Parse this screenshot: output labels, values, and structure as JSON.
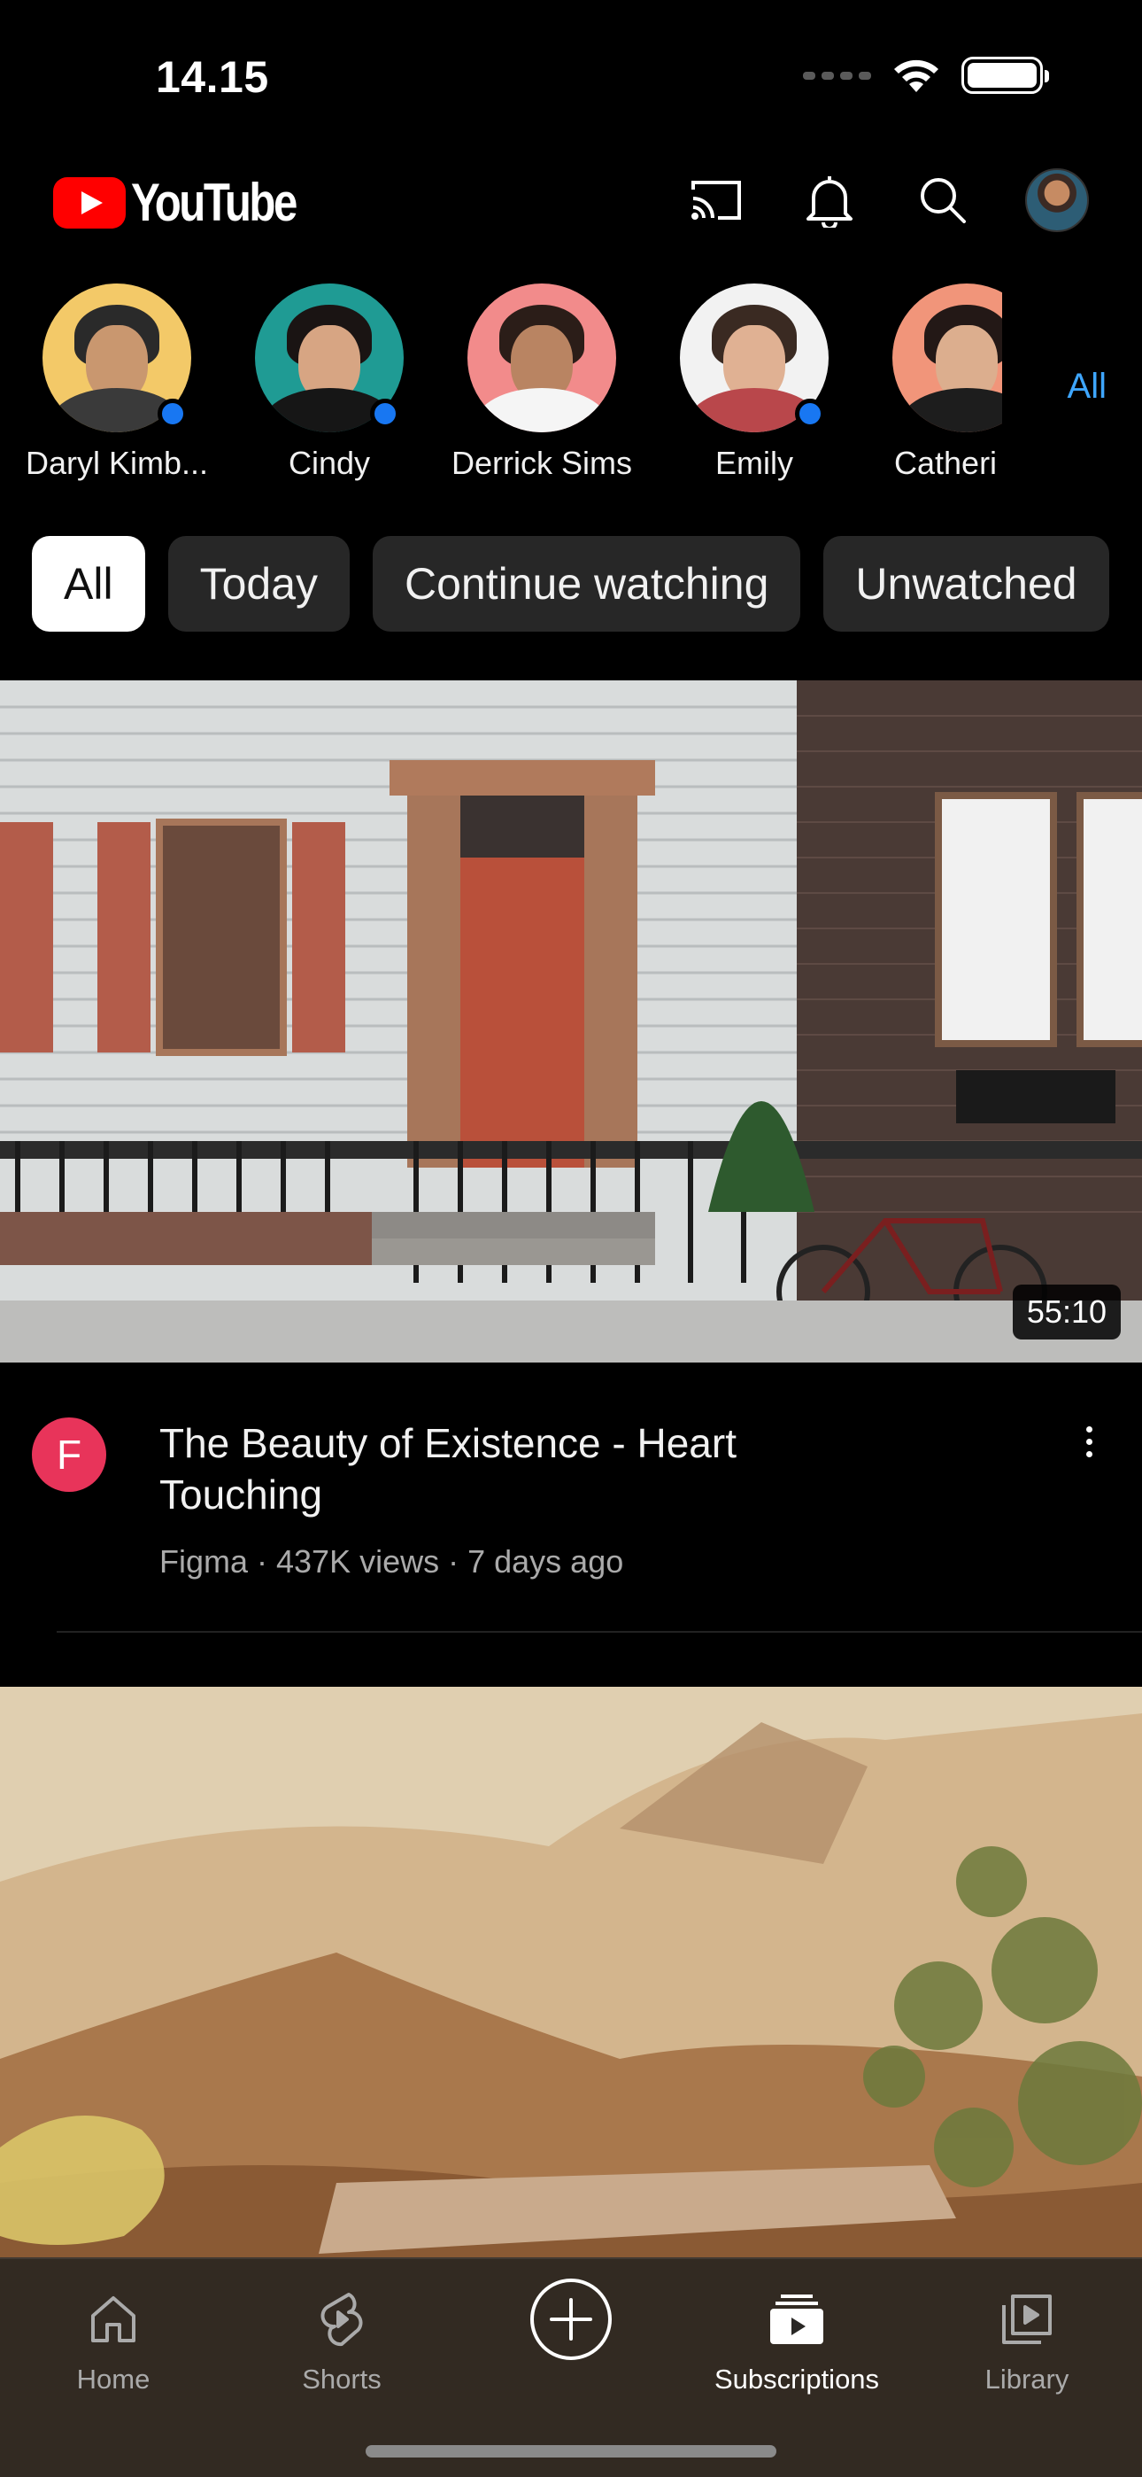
{
  "status_bar": {
    "time": "14.15"
  },
  "header": {
    "logo_text": "YouTube",
    "brand_color": "#FF0000",
    "actions": [
      "cast-icon",
      "bell-icon",
      "search-icon",
      "account-avatar"
    ]
  },
  "channels": {
    "items": [
      {
        "name": "Daryl Kimb...",
        "has_new": true,
        "avatar_color": "#f3c968"
      },
      {
        "name": "Cindy",
        "has_new": true,
        "avatar_color": "#1f9b94"
      },
      {
        "name": "Derrick Sims",
        "has_new": false,
        "avatar_color": "#f28b8b"
      },
      {
        "name": "Emily",
        "has_new": true,
        "avatar_color": "#f2f2f2"
      },
      {
        "name": "Catheri",
        "has_new": false,
        "avatar_color": "#f1957a"
      }
    ],
    "all_label": "All"
  },
  "chips": [
    {
      "label": "All",
      "active": true
    },
    {
      "label": "Today",
      "active": false
    },
    {
      "label": "Continue watching",
      "active": false
    },
    {
      "label": "Unwatched",
      "active": false
    }
  ],
  "videos": [
    {
      "duration": "55:10",
      "channel_initial": "F",
      "title": "The Beauty of Existence - Heart Touching",
      "subtitle": "Figma · 437K views · 7 days ago"
    }
  ],
  "bottom_nav": [
    {
      "label": "Home",
      "icon": "home-icon",
      "active": false
    },
    {
      "label": "Shorts",
      "icon": "shorts-icon",
      "active": false
    },
    {
      "label": "",
      "icon": "create-icon",
      "active": false
    },
    {
      "label": "Subscriptions",
      "icon": "subscriptions-icon",
      "active": true
    },
    {
      "label": "Library",
      "icon": "library-icon",
      "active": false
    }
  ]
}
